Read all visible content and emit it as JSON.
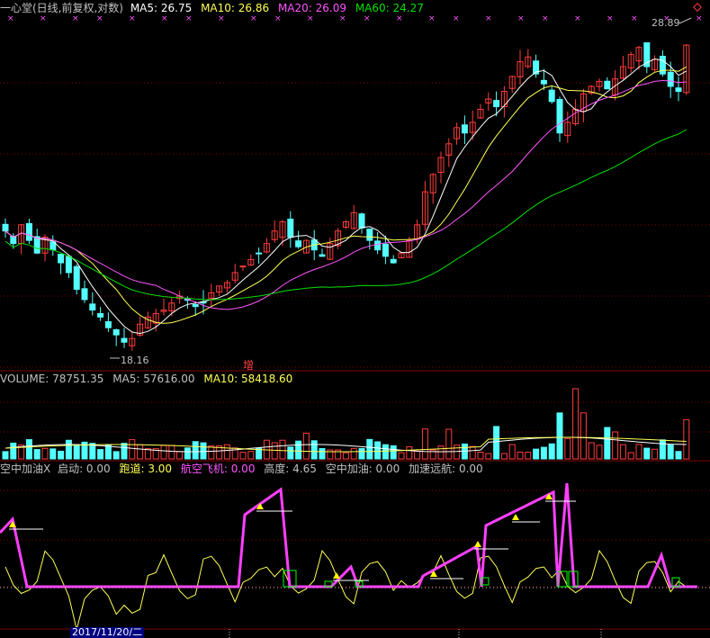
{
  "main": {
    "title": "一心堂(日线,前复权,对数)",
    "ma5_label": "MA5: 26.75",
    "ma10_label": "MA10: 26.86",
    "ma20_label": "MA20: 26.09",
    "ma60_label": "MA60: 24.27",
    "high_label": "28.89",
    "low_label": "18.16",
    "badge": "增"
  },
  "volume": {
    "label": "VOLUME: 78751.35",
    "ma5_label": "MA5: 57616.00",
    "ma10_label": "MA10: 58418.60"
  },
  "indicator": {
    "name": "空中加油X",
    "qidong": "启动: 0.00",
    "paodao": "跑道: 3.00",
    "hangkong": "航空飞机: 0.00",
    "gaodu": "高度: 4.65",
    "kongzhong": "空中加油: 0.00",
    "jiasu": "加速远航: 0.00"
  },
  "footer": {
    "date": "2017/11/20/二"
  },
  "colors": {
    "up": "#ff3c3c",
    "down": "#54ffff",
    "ma5": "#ffffff",
    "ma10": "#ffff54",
    "ma20": "#ff54ff",
    "ma60": "#00e000",
    "grid": "#800000"
  },
  "chart_data": [
    {
      "type": "candlestick",
      "title": "一心堂(日线,前复权,对数)",
      "scale": "log",
      "series": [
        {
          "name": "MA5",
          "value": 26.75
        },
        {
          "name": "MA10",
          "value": 26.86
        },
        {
          "name": "MA20",
          "value": 26.09
        },
        {
          "name": "MA60",
          "value": 24.27
        }
      ],
      "annotations": [
        {
          "text": "28.89",
          "kind": "high"
        },
        {
          "text": "18.16",
          "kind": "low"
        },
        {
          "text": "增"
        }
      ],
      "close": [
        21.6,
        21.2,
        21.8,
        21.3,
        20.9,
        21.4,
        21.0,
        20.6,
        20.3,
        19.8,
        19.5,
        19.2,
        19.0,
        18.7,
        18.5,
        18.3,
        18.4,
        18.8,
        19.0,
        19.1,
        19.2,
        19.4,
        19.6,
        19.5,
        19.3,
        19.4,
        19.7,
        19.9,
        20.0,
        20.3,
        20.5,
        20.7,
        20.9,
        21.2,
        21.6,
        21.9,
        21.4,
        21.1,
        21.3,
        21.0,
        20.8,
        21.2,
        21.6,
        21.9,
        22.2,
        21.7,
        21.3,
        21.0,
        20.8,
        20.6,
        20.9,
        21.3,
        21.8,
        22.9,
        23.5,
        24.1,
        24.6,
        25.2,
        25.0,
        25.4,
        25.9,
        26.3,
        26.0,
        26.6,
        27.2,
        27.8,
        28.0,
        27.3,
        26.9,
        26.2,
        25.0,
        25.4,
        25.9,
        26.5,
        26.8,
        27.0,
        26.7,
        27.1,
        27.6,
        28.1,
        28.4,
        27.6,
        27.9,
        27.3,
        26.8,
        26.6,
        28.5
      ]
    },
    {
      "type": "bar",
      "title": "VOLUME: 78751.35",
      "series": [
        {
          "name": "VOLUME",
          "value": 78751.35
        },
        {
          "name": "MA5",
          "value": 57616.0
        },
        {
          "name": "MA10",
          "value": 58418.6
        }
      ]
    },
    {
      "type": "line",
      "title": "空中加油X",
      "series": [
        {
          "name": "启动",
          "value": 0.0
        },
        {
          "name": "跑道",
          "value": 3.0
        },
        {
          "name": "航空飞机",
          "value": 0.0
        },
        {
          "name": "高度",
          "value": 4.65
        },
        {
          "name": "空中加油",
          "value": 0.0
        },
        {
          "name": "加速远航",
          "value": 0.0
        }
      ]
    }
  ]
}
